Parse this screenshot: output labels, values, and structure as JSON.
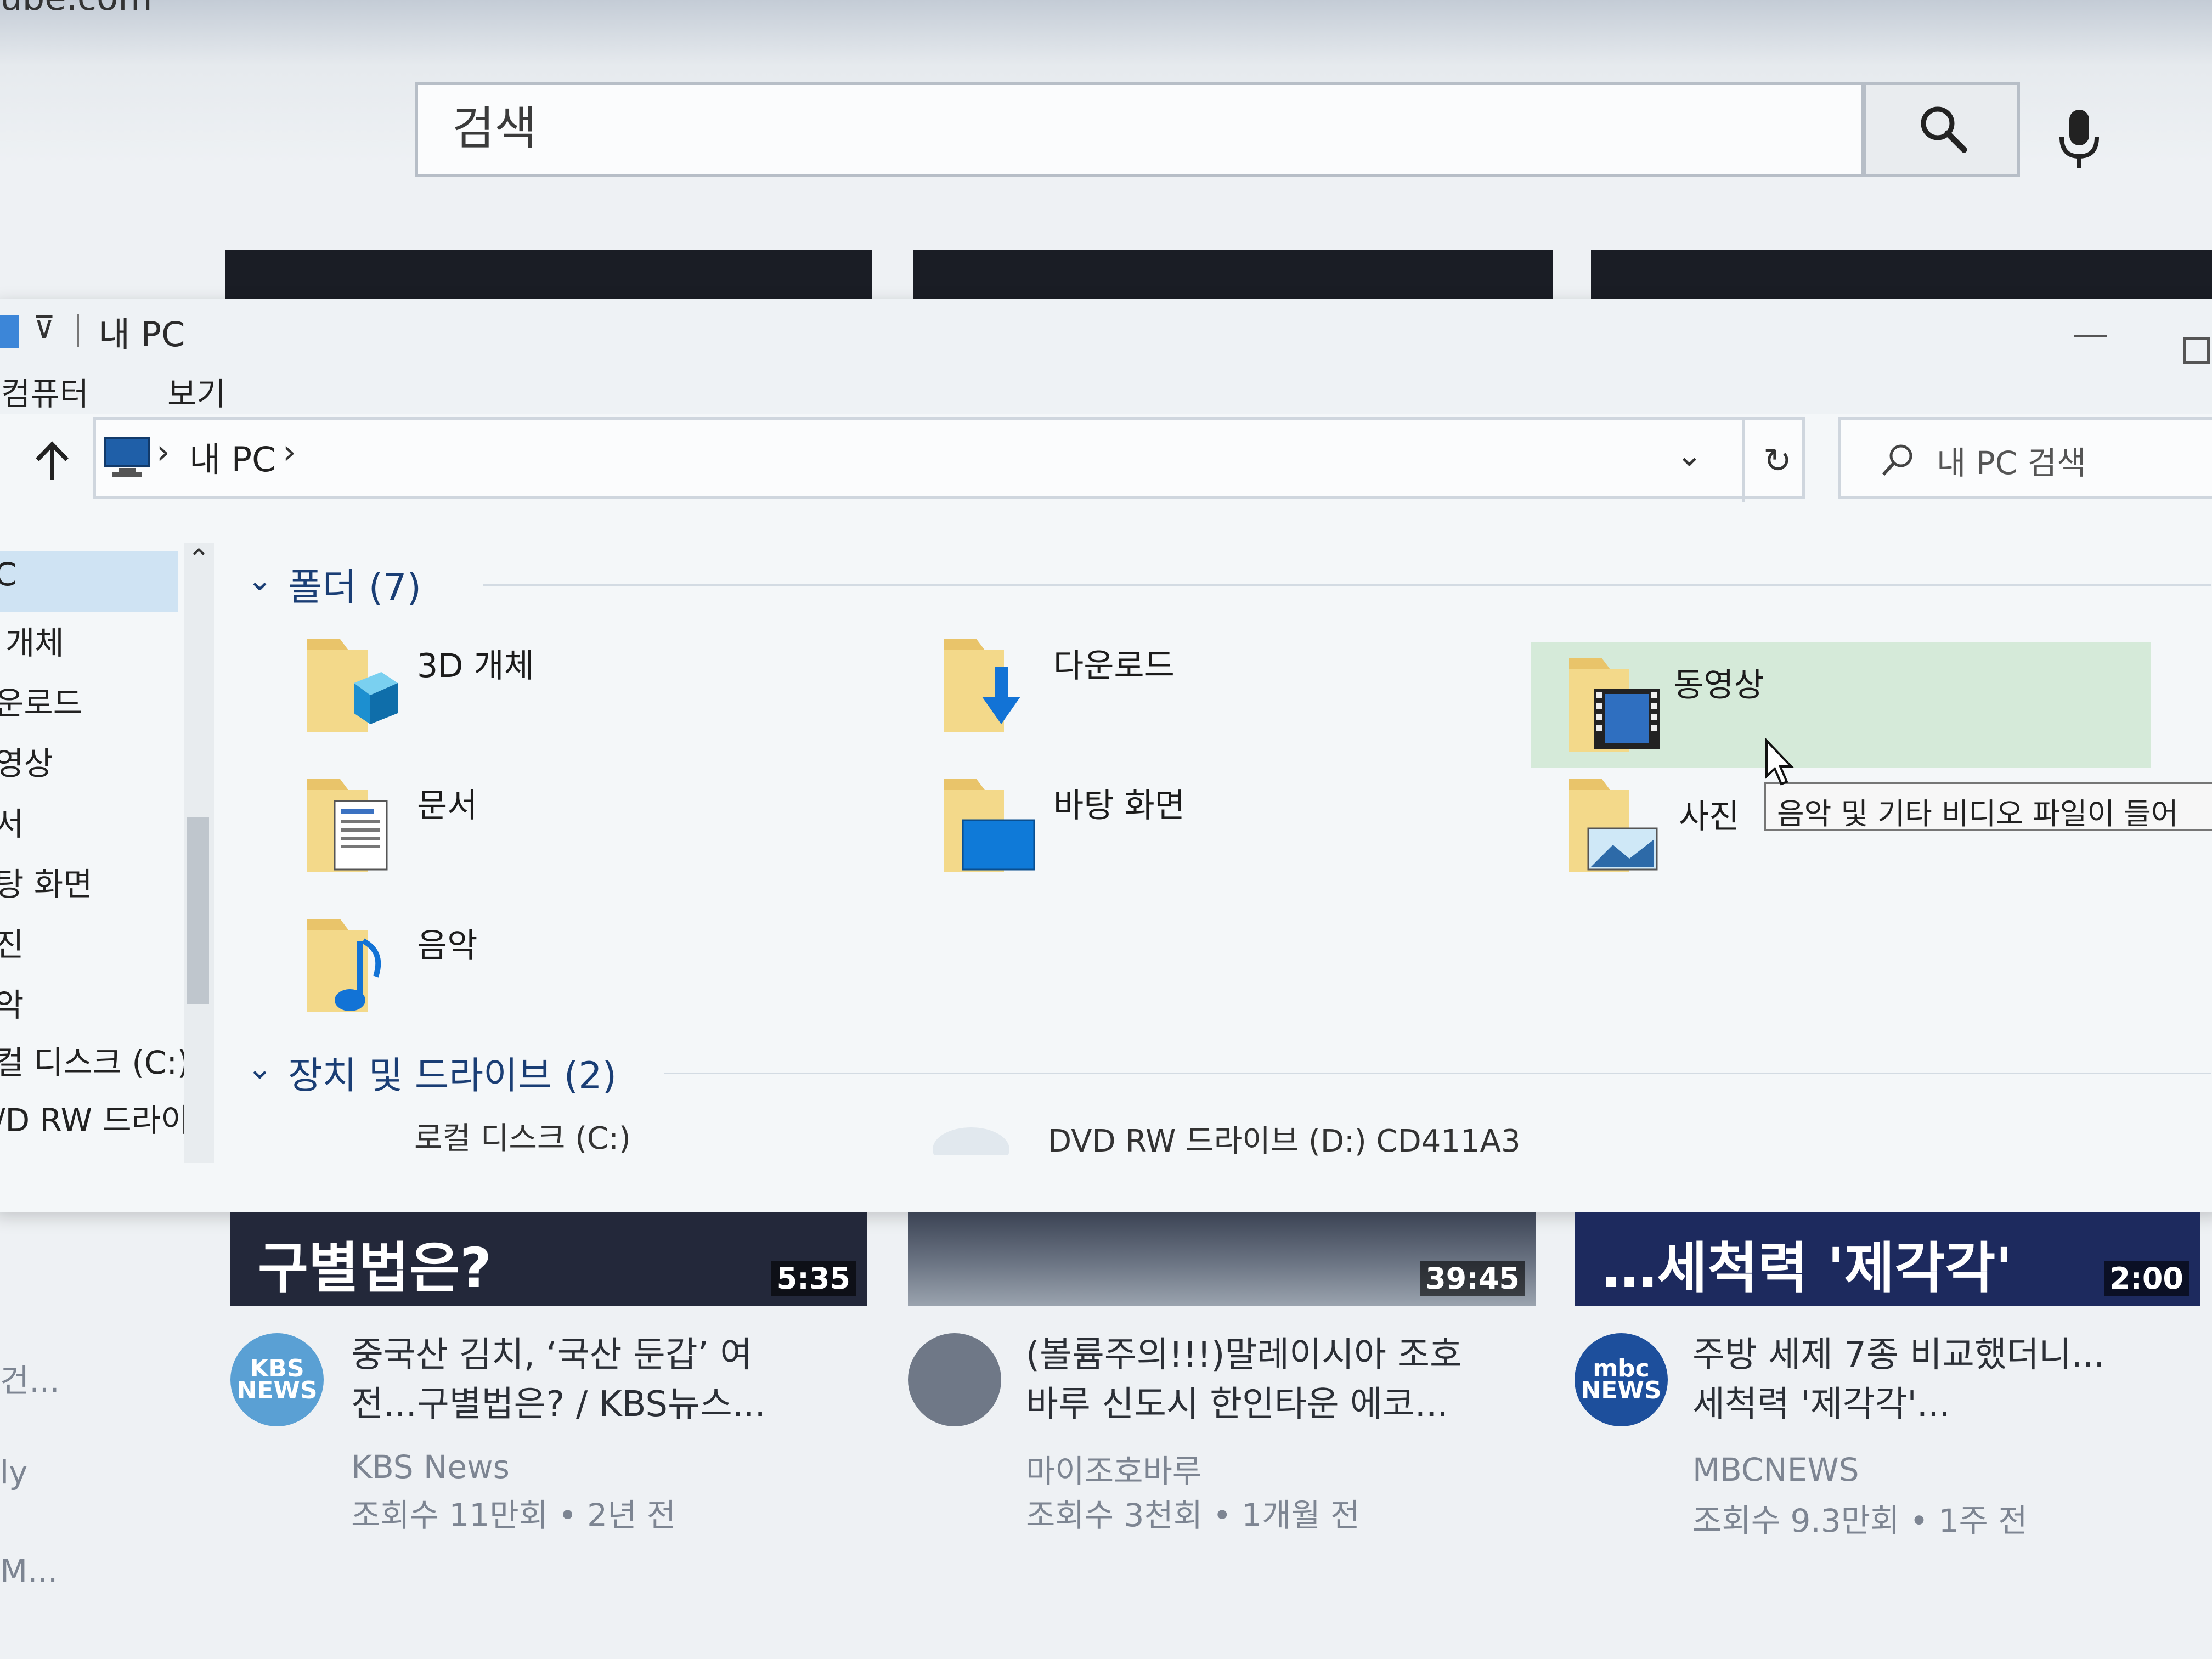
{
  "browser": {
    "url_fragment": "ube.com"
  },
  "youtube": {
    "search_placeholder": "검색",
    "side_fragments": [
      "건...",
      "ly",
      "M..."
    ]
  },
  "explorer": {
    "title": "내 PC",
    "quick_access_dropdown": "⊽",
    "ribbon_tabs": [
      "컴퓨터",
      "보기"
    ],
    "breadcrumb": [
      "내 PC"
    ],
    "search_placeholder": "내 PC 검색",
    "nav_items": [
      "C",
      "개체",
      "운로드",
      "영상",
      "서",
      "탕 화면",
      "진",
      "악",
      "컬 디스크 (C:)",
      "/D RW 드라이"
    ],
    "folders_header": "폴더 (7)",
    "folders": [
      {
        "label": "3D 개체",
        "icon": "3d-objects-folder-icon"
      },
      {
        "label": "다운로드",
        "icon": "downloads-folder-icon"
      },
      {
        "label": "동영상",
        "icon": "videos-folder-icon"
      },
      {
        "label": "문서",
        "icon": "documents-folder-icon"
      },
      {
        "label": "바탕 화면",
        "icon": "desktop-folder-icon"
      },
      {
        "label": "사진",
        "icon": "pictures-folder-icon"
      },
      {
        "label": "음악",
        "icon": "music-folder-icon"
      }
    ],
    "drives_header": "장치 및 드라이브 (2)",
    "drives": [
      {
        "label": "로컬 디스크 (C:)"
      },
      {
        "label": "DVD RW 드라이브 (D:) CD411A3"
      }
    ],
    "tooltip": "음악 및 기타 비디오 파일이 들어"
  },
  "videos": [
    {
      "thumb_caption": "구별법은?",
      "duration": "5:35",
      "avatar": "KBS NEWS",
      "title": "중국산 김치, ‘국산 둔갑’ 여전...구별법은? / KBS뉴스...",
      "channel": "KBS News",
      "meta": "조회수 11만회 • 2년 전"
    },
    {
      "thumb_caption": "",
      "duration": "39:45",
      "avatar": "",
      "title": "(볼륨주의!!!)말레이시아 조호바루 신도시 한인타운 에코...",
      "channel": "마이조호바루",
      "meta": "조회수 3천회 • 1개월 전"
    },
    {
      "thumb_caption": "…세척력 '제각각'",
      "duration": "2:00",
      "avatar": "mbc NEWS",
      "title": "주방 세제 7종 비교했더니...세척력 '제각각'...",
      "channel": "MBCNEWS",
      "meta": "조회수 9.3만회 • 1주 전"
    }
  ],
  "colors": {
    "accent": "#0078d7",
    "hover_tile": "#d5ead9",
    "group_header": "#1a3e75"
  }
}
